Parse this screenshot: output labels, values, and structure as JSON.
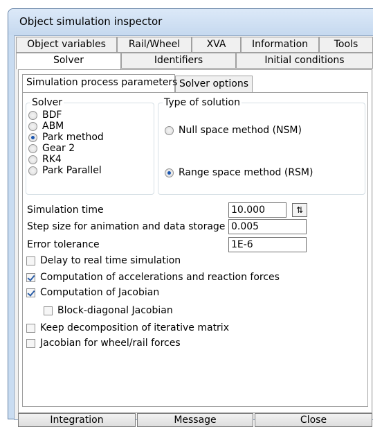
{
  "window": {
    "title": "Object simulation inspector"
  },
  "tabs_row1": [
    "Object variables",
    "Rail/Wheel",
    "XVA",
    "Information",
    "Tools"
  ],
  "tabs_row2": [
    "Solver",
    "Identifiers",
    "Initial conditions"
  ],
  "subtabs": [
    "Simulation process parameters",
    "Solver options"
  ],
  "solver_group": {
    "legend": "Solver",
    "options": [
      "BDF",
      "ABM",
      "Park method",
      "Gear 2",
      "RK4",
      "Park Parallel"
    ],
    "selected": "Park method"
  },
  "solution_group": {
    "legend": "Type of solution",
    "options": [
      "Null space method (NSM)",
      "Range space method (RSM)"
    ],
    "selected": "Range space method (RSM)"
  },
  "params": {
    "sim_time_label": "Simulation time",
    "sim_time_value": "10.000",
    "step_label": "Step size for animation and data storage",
    "step_value": "0.005",
    "tol_label": "Error tolerance",
    "tol_value": "1E-6"
  },
  "checks": {
    "delay": {
      "label": "Delay to real time simulation",
      "checked": false
    },
    "accel": {
      "label": "Computation of accelerations and reaction forces",
      "checked": true
    },
    "jacobian": {
      "label": "Computation of Jacobian",
      "checked": true
    },
    "blockdiag": {
      "label": "Block-diagonal Jacobian",
      "checked": false
    },
    "decomp": {
      "label": "Keep decomposition of iterative matrix",
      "checked": false
    },
    "wheelrail": {
      "label": "Jacobian for wheel/rail forces",
      "checked": false
    }
  },
  "buttons": {
    "integration": "Integration",
    "message": "Message",
    "close": "Close"
  },
  "icons": {
    "spin": "up-down-arrows-icon"
  }
}
